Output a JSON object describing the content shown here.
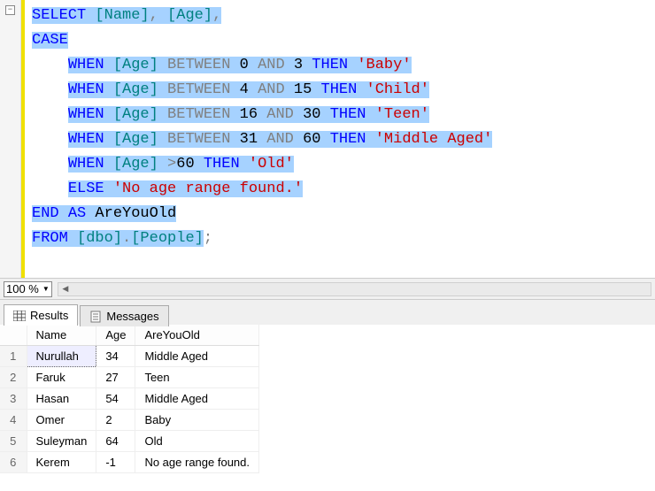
{
  "zoom": "100 %",
  "code": {
    "line1": {
      "select": "SELECT",
      "col1": "[Name]",
      "comma1": ", ",
      "col2": "[Age]",
      "comma2": ","
    },
    "line2": {
      "case": "CASE"
    },
    "when_between": [
      {
        "when": "WHEN",
        "col": "[Age]",
        "between": "BETWEEN",
        "v1": "0",
        "and": "AND",
        "v2": "3",
        "then": "THEN",
        "label": "'Baby'"
      },
      {
        "when": "WHEN",
        "col": "[Age]",
        "between": "BETWEEN",
        "v1": "4",
        "and": "AND",
        "v2": "15",
        "then": "THEN",
        "label": "'Child'"
      },
      {
        "when": "WHEN",
        "col": "[Age]",
        "between": "BETWEEN",
        "v1": "16",
        "and": "AND",
        "v2": "30",
        "then": "THEN",
        "label": "'Teen'"
      },
      {
        "when": "WHEN",
        "col": "[Age]",
        "between": "BETWEEN",
        "v1": "31",
        "and": "AND",
        "v2": "60",
        "then": "THEN",
        "label": "'Middle Aged'"
      }
    ],
    "when_gt": {
      "when": "WHEN",
      "col": "[Age]",
      "op": ">",
      "v": "60",
      "then": "THEN",
      "label": "'Old'"
    },
    "else_line": {
      "else": "ELSE",
      "label": "'No age range found.'"
    },
    "end_line": {
      "end": "END",
      "as": "AS",
      "alias": "AreYouOld"
    },
    "from_line": {
      "from": "FROM",
      "schema": "[dbo]",
      "dot": ".",
      "table": "[People]",
      "semi": ";"
    }
  },
  "tabs": {
    "results": "Results",
    "messages": "Messages"
  },
  "columns": [
    "",
    "Name",
    "Age",
    "AreYouOld"
  ],
  "rows": [
    {
      "n": "1",
      "name": "Nurullah",
      "age": "34",
      "old": "Middle Aged"
    },
    {
      "n": "2",
      "name": "Faruk",
      "age": "27",
      "old": "Teen"
    },
    {
      "n": "3",
      "name": "Hasan",
      "age": "54",
      "old": "Middle Aged"
    },
    {
      "n": "4",
      "name": "Omer",
      "age": "2",
      "old": "Baby"
    },
    {
      "n": "5",
      "name": "Suleyman",
      "age": "64",
      "old": "Old"
    },
    {
      "n": "6",
      "name": "Kerem",
      "age": "-1",
      "old": "No age range found."
    }
  ]
}
